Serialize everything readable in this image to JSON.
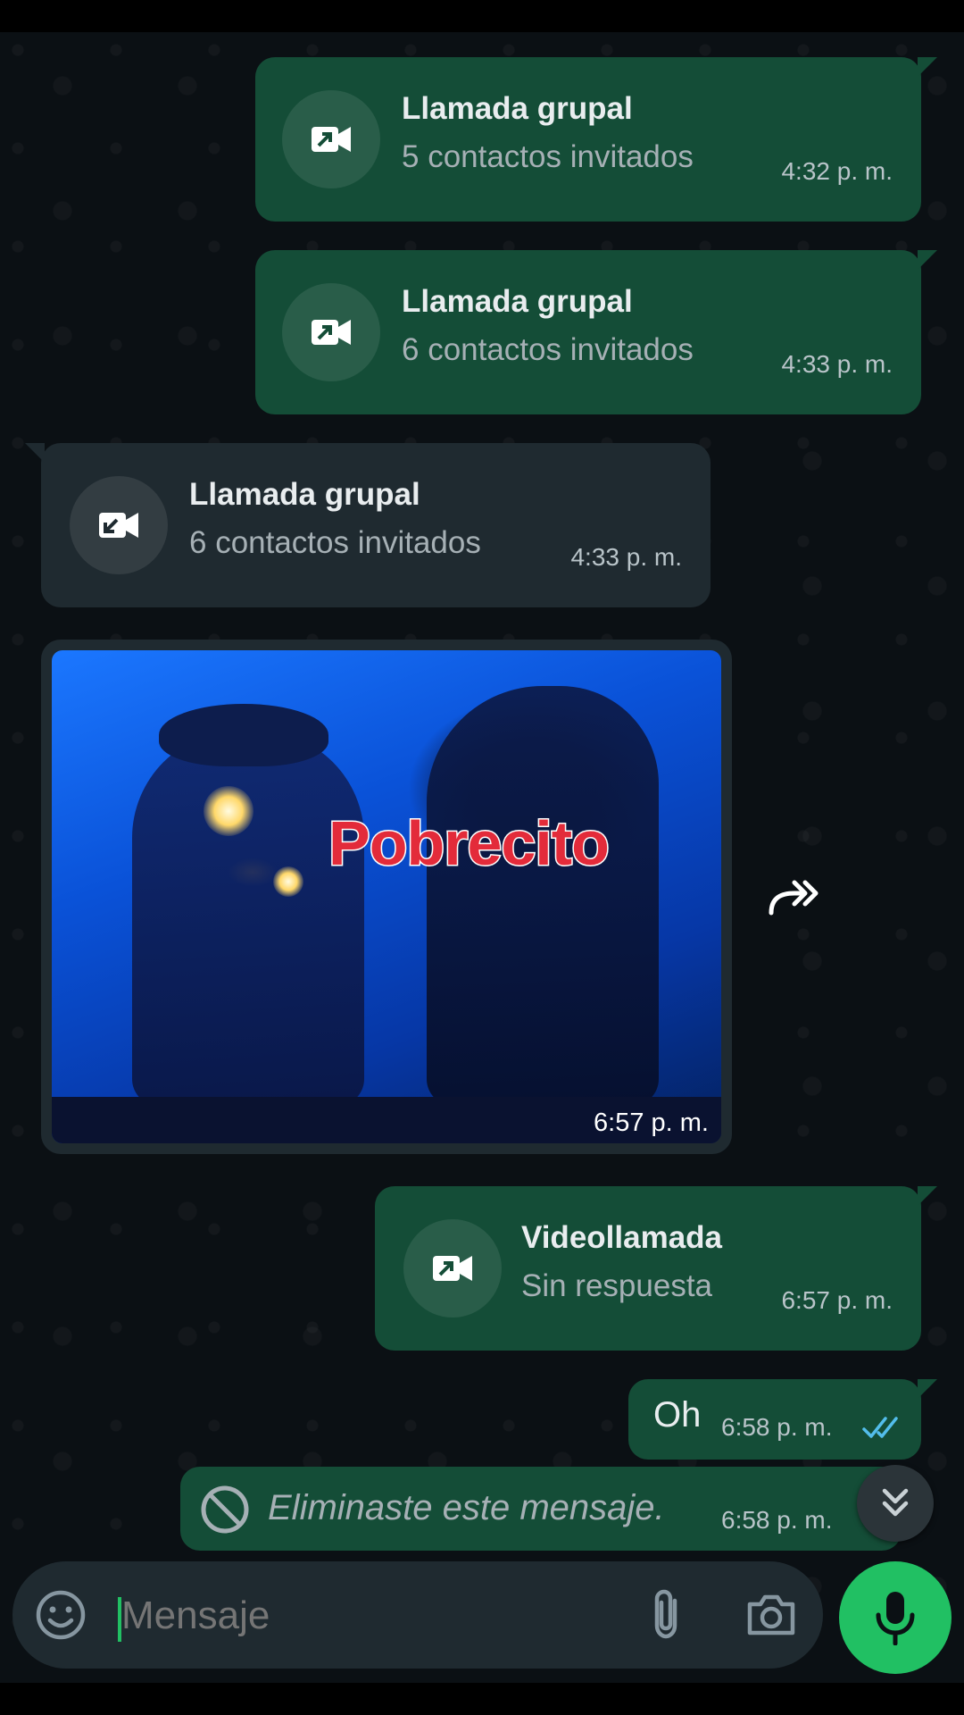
{
  "messages": {
    "call1": {
      "title": "Llamada grupal",
      "subtitle": "5 contactos invitados",
      "time": "4:32 p. m."
    },
    "call2": {
      "title": "Llamada grupal",
      "subtitle": "6 contactos invitados",
      "time": "4:33 p. m."
    },
    "call3": {
      "title": "Llamada grupal",
      "subtitle": "6 contactos invitados",
      "time": "4:33 p. m."
    },
    "media": {
      "caption_text": "Pobrecito",
      "time": "6:57 p. m."
    },
    "video_call": {
      "title": "Videollamada",
      "subtitle": "Sin respuesta",
      "time": "6:57 p. m."
    },
    "text_oh": {
      "text": "Oh",
      "time": "6:58 p. m."
    },
    "deleted": {
      "text": "Eliminaste este mensaje.",
      "time": "6:58 p. m."
    }
  },
  "composer": {
    "placeholder": "Mensaje"
  },
  "colors": {
    "accent": "#21c063",
    "outgoing_bubble": "#144d37",
    "incoming_bubble": "#1f2a30",
    "read_ticks": "#53bdeb"
  },
  "icons": [
    "video-call-outgoing-icon",
    "video-call-incoming-icon",
    "forward-icon",
    "blocked-icon",
    "double-chevron-down-icon",
    "emoji-icon",
    "paperclip-icon",
    "camera-icon",
    "mic-icon",
    "double-check-icon"
  ]
}
